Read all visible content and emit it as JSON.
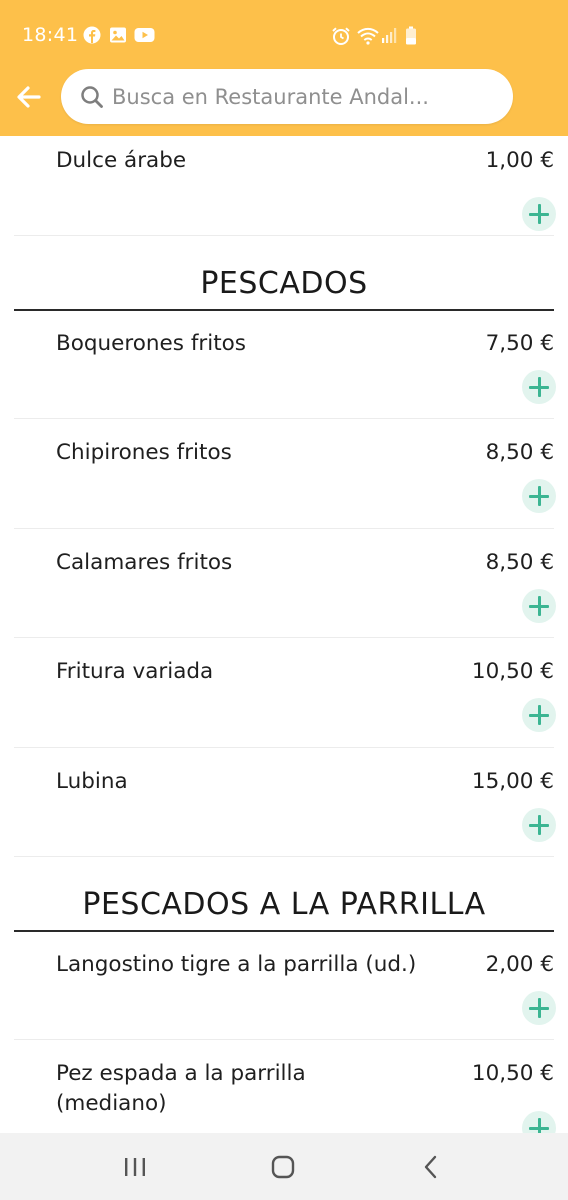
{
  "status_bar": {
    "time": "18:41",
    "left_icons": [
      "facebook-icon",
      "image-icon",
      "youtube-icon"
    ],
    "right_icons": [
      "alarm-icon",
      "wifi-icon",
      "signal-icon",
      "battery-icon"
    ]
  },
  "header": {
    "back_icon": "arrow-left-icon",
    "search_placeholder": "Busca en Restaurante Andal...",
    "accent_color": "#fdc04a"
  },
  "menu": {
    "top_item": {
      "name": "Dulce árabe",
      "price": "1,00 €"
    },
    "sections": [
      {
        "title": "PESCADOS",
        "items": [
          {
            "name": "Boquerones fritos",
            "price": "7,50 €"
          },
          {
            "name": "Chipirones fritos",
            "price": "8,50 €"
          },
          {
            "name": "Calamares fritos",
            "price": "8,50 €"
          },
          {
            "name": "Fritura variada",
            "price": "10,50 €"
          },
          {
            "name": "Lubina",
            "price": "15,00 €"
          }
        ]
      },
      {
        "title": "PESCADOS A LA PARRILLA",
        "items": [
          {
            "name": "Langostino tigre a la parrilla (ud.)",
            "price": "2,00 €"
          },
          {
            "name": "Pez espada a la parrilla (mediano)",
            "price": "10,50 €"
          }
        ]
      }
    ],
    "add_icon": "plus-icon",
    "add_color": "#3bb592"
  },
  "nav_bar": {
    "buttons": [
      "recent-apps-icon",
      "home-icon",
      "back-icon"
    ]
  }
}
